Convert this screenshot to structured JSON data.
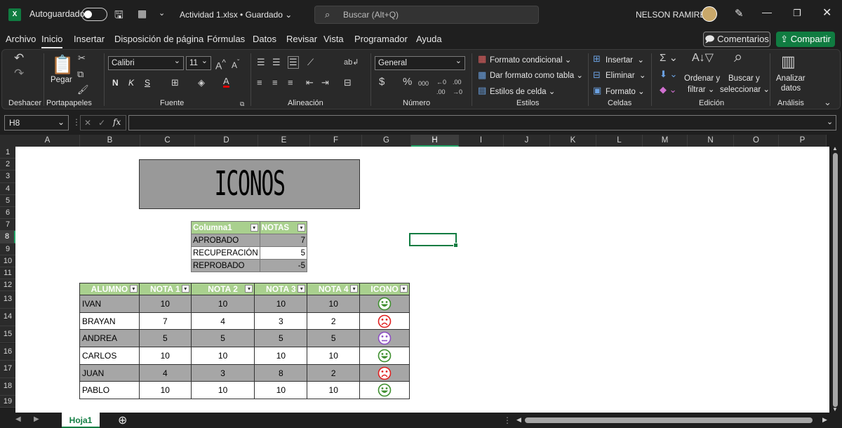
{
  "titlebar": {
    "autosave_label": "Autoguardado",
    "file_title": "Actividad 1.xlsx • Guardado",
    "search_placeholder": "Buscar (Alt+Q)",
    "user_name": "NELSON RAMIREZ"
  },
  "menu": [
    "Archivo",
    "Inicio",
    "Insertar",
    "Disposición de página",
    "Fórmulas",
    "Datos",
    "Revisar",
    "Vista",
    "Programador",
    "Ayuda"
  ],
  "buttons": {
    "comments": "Comentarios",
    "share": "Compartir"
  },
  "ribbon": {
    "paste": "Pegar",
    "font_name": "Calibri",
    "font_size": "11",
    "number_format": "General",
    "bold": "N",
    "italic": "K",
    "underline": "S",
    "cond_format": "Formato condicional",
    "table_format": "Dar formato como tabla",
    "cell_styles": "Estilos de celda",
    "insert": "Insertar",
    "delete": "Eliminar",
    "format": "Formato",
    "sort_l1": "Ordenar y",
    "sort_l2": "filtrar",
    "find_l1": "Buscar y",
    "find_l2": "seleccionar",
    "analyze_l1": "Analizar",
    "analyze_l2": "datos",
    "groups": [
      "Deshacer",
      "Portapapeles",
      "Fuente",
      "Alineación",
      "Número",
      "Estilos",
      "Celdas",
      "Edición",
      "Análisis"
    ]
  },
  "formula_bar": {
    "name_box": "H8",
    "formula": ""
  },
  "columns": [
    "A",
    "B",
    "C",
    "D",
    "E",
    "F",
    "G",
    "H",
    "I",
    "J",
    "K",
    "L",
    "M",
    "N",
    "O",
    "P"
  ],
  "rows": [
    "1",
    "2",
    "3",
    "4",
    "5",
    "6",
    "7",
    "8",
    "9",
    "10",
    "11",
    "12",
    "13",
    "14",
    "15",
    "16",
    "17",
    "18",
    "19"
  ],
  "selected_col": "H",
  "selected_row": "8",
  "banner": "ICONOS",
  "table1": {
    "headers": [
      "Columna1",
      "NOTAS"
    ],
    "rows": [
      [
        "APROBADO",
        "7"
      ],
      [
        "RECUPERACIÓN",
        "5"
      ],
      [
        "REPROBADO",
        "-5"
      ]
    ]
  },
  "table2": {
    "headers": [
      "ALUMNO",
      "NOTA 1",
      "NOTA 2",
      "NOTA 3",
      "NOTA 4",
      "ICONO"
    ],
    "rows": [
      {
        "name": "IVAN",
        "n": [
          "10",
          "10",
          "10",
          "10"
        ],
        "icon": "happy-face-icon",
        "color": "#3f8f2f"
      },
      {
        "name": "BRAYAN",
        "n": [
          "7",
          "4",
          "3",
          "2"
        ],
        "icon": "sad-face-icon",
        "color": "#e02020"
      },
      {
        "name": "ANDREA",
        "n": [
          "5",
          "5",
          "5",
          "5"
        ],
        "icon": "neutral-face-icon",
        "color": "#8e4fc4"
      },
      {
        "name": "CARLOS",
        "n": [
          "10",
          "10",
          "10",
          "10"
        ],
        "icon": "happy-face-icon",
        "color": "#3f8f2f"
      },
      {
        "name": "JUAN",
        "n": [
          "4",
          "3",
          "8",
          "2"
        ],
        "icon": "sad-face-icon",
        "color": "#e02020"
      },
      {
        "name": "PABLO",
        "n": [
          "10",
          "10",
          "10",
          "10"
        ],
        "icon": "happy-face-icon",
        "color": "#3f8f2f"
      }
    ]
  },
  "sheet_tab": "Hoja1"
}
